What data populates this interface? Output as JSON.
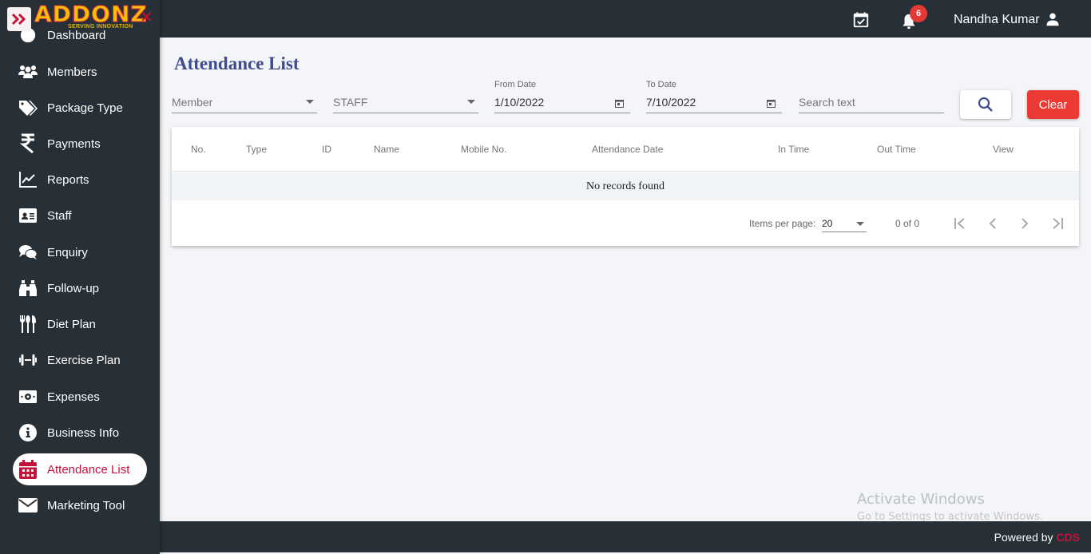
{
  "app": {
    "logo_text": "ADDONZ",
    "logo_tagline": "SERVING INNOVATION",
    "close_icon": "close-icon"
  },
  "header": {
    "notification_count": "6",
    "user_name": "Nandha Kumar",
    "icons": [
      "calendar-check-icon",
      "bell-icon",
      "user-icon"
    ]
  },
  "sidebar": {
    "items": [
      {
        "label": "Dashboard",
        "icon": "dashboard-icon"
      },
      {
        "label": "Members",
        "icon": "users-icon"
      },
      {
        "label": "Package Type",
        "icon": "tags-icon"
      },
      {
        "label": "Payments",
        "icon": "rupee-icon"
      },
      {
        "label": "Reports",
        "icon": "chart-line-icon"
      },
      {
        "label": "Staff",
        "icon": "id-card-icon"
      },
      {
        "label": "Enquiry",
        "icon": "comments-icon"
      },
      {
        "label": "Follow-up",
        "icon": "binoculars-icon"
      },
      {
        "label": "Diet Plan",
        "icon": "utensils-icon"
      },
      {
        "label": "Exercise Plan",
        "icon": "dumbbell-icon"
      },
      {
        "label": "Expenses",
        "icon": "money-bill-icon"
      },
      {
        "label": "Business Info",
        "icon": "info-circle-icon"
      },
      {
        "label": "Attendance List",
        "icon": "calendar-icon",
        "active": true
      },
      {
        "label": "Marketing Tool",
        "icon": "envelope-icon"
      }
    ]
  },
  "main": {
    "title": "Attendance List",
    "filters": {
      "member_placeholder": "Member",
      "type_value": "STAFF",
      "from_date_label": "From Date",
      "from_date_value": "1/10/2022",
      "to_date_label": "To Date",
      "to_date_value": "7/10/2022",
      "search_placeholder": "Search text",
      "clear_label": "Clear"
    },
    "table": {
      "columns": [
        "No.",
        "Type",
        "ID",
        "Name",
        "Mobile No.",
        "Attendance Date",
        "In Time",
        "Out Time",
        "View"
      ],
      "empty_message": "No records found"
    },
    "paginator": {
      "items_per_page_label": "Items per page:",
      "items_per_page_value": "20",
      "range_label": "0 of 0"
    }
  },
  "watermark": {
    "line1": "Activate Windows",
    "line2": "Go to Settings to activate Windows."
  },
  "footer": {
    "powered_by": "Powered by",
    "brand": "CDS"
  },
  "colors": {
    "sidebar_bg": "#283037",
    "active_accent": "#c2133b",
    "title_color": "#3d4b8f",
    "clear_button": "#ea3a33",
    "badge": "#e53935"
  }
}
